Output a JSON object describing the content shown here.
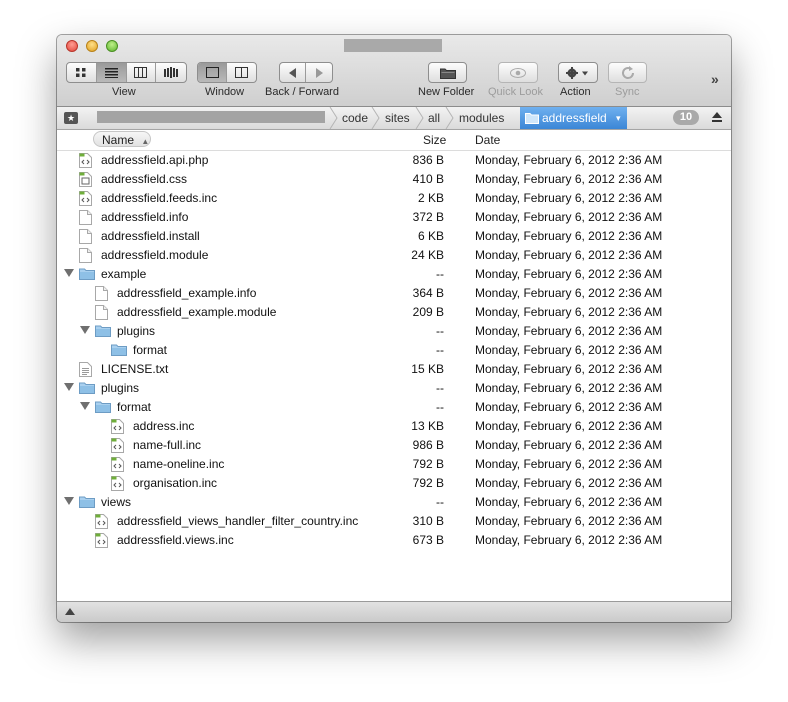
{
  "toolbar": {
    "view_label": "View",
    "window_label": "Window",
    "back_forward_label": "Back / Forward",
    "new_folder_label": "New Folder",
    "quick_look_label": "Quick Look",
    "action_label": "Action",
    "sync_label": "Sync",
    "overflow": "»"
  },
  "pathbar": {
    "crumbs": [
      "code",
      "sites",
      "all",
      "modules"
    ],
    "current": "addressfield",
    "item_count": "10"
  },
  "columns": {
    "name": "Name",
    "size": "Size",
    "date": "Date"
  },
  "rows": [
    {
      "name": "addressfield.api.php",
      "size": "836 B",
      "date": "Monday, February 6, 2012 2:36 AM",
      "icon": "code-file-icon",
      "indent": 0,
      "disclosure": "none"
    },
    {
      "name": "addressfield.css",
      "size": "410 B",
      "date": "Monday, February 6, 2012 2:36 AM",
      "icon": "css-file-icon",
      "indent": 0,
      "disclosure": "none"
    },
    {
      "name": "addressfield.feeds.inc",
      "size": "2 KB",
      "date": "Monday, February 6, 2012 2:36 AM",
      "icon": "code-file-icon",
      "indent": 0,
      "disclosure": "none"
    },
    {
      "name": "addressfield.info",
      "size": "372 B",
      "date": "Monday, February 6, 2012 2:36 AM",
      "icon": "blank-file-icon",
      "indent": 0,
      "disclosure": "none"
    },
    {
      "name": "addressfield.install",
      "size": "6 KB",
      "date": "Monday, February 6, 2012 2:36 AM",
      "icon": "blank-file-icon",
      "indent": 0,
      "disclosure": "none"
    },
    {
      "name": "addressfield.module",
      "size": "24 KB",
      "date": "Monday, February 6, 2012 2:36 AM",
      "icon": "blank-file-icon",
      "indent": 0,
      "disclosure": "none"
    },
    {
      "name": "example",
      "size": "--",
      "date": "Monday, February 6, 2012 2:36 AM",
      "icon": "folder-icon",
      "indent": 0,
      "disclosure": "open"
    },
    {
      "name": "addressfield_example.info",
      "size": "364 B",
      "date": "Monday, February 6, 2012 2:36 AM",
      "icon": "blank-file-icon",
      "indent": 1,
      "disclosure": "none"
    },
    {
      "name": "addressfield_example.module",
      "size": "209 B",
      "date": "Monday, February 6, 2012 2:36 AM",
      "icon": "blank-file-icon",
      "indent": 1,
      "disclosure": "none"
    },
    {
      "name": "plugins",
      "size": "--",
      "date": "Monday, February 6, 2012 2:36 AM",
      "icon": "folder-icon",
      "indent": 1,
      "disclosure": "open"
    },
    {
      "name": "format",
      "size": "--",
      "date": "Monday, February 6, 2012 2:36 AM",
      "icon": "folder-icon",
      "indent": 2,
      "disclosure": "closed"
    },
    {
      "name": "LICENSE.txt",
      "size": "15 KB",
      "date": "Monday, February 6, 2012 2:36 AM",
      "icon": "text-file-icon",
      "indent": 0,
      "disclosure": "none"
    },
    {
      "name": "plugins",
      "size": "--",
      "date": "Monday, February 6, 2012 2:36 AM",
      "icon": "folder-icon",
      "indent": 0,
      "disclosure": "open"
    },
    {
      "name": "format",
      "size": "--",
      "date": "Monday, February 6, 2012 2:36 AM",
      "icon": "folder-icon",
      "indent": 1,
      "disclosure": "open"
    },
    {
      "name": "address.inc",
      "size": "13 KB",
      "date": "Monday, February 6, 2012 2:36 AM",
      "icon": "code-file-icon",
      "indent": 2,
      "disclosure": "none"
    },
    {
      "name": "name-full.inc",
      "size": "986 B",
      "date": "Monday, February 6, 2012 2:36 AM",
      "icon": "code-file-icon",
      "indent": 2,
      "disclosure": "none"
    },
    {
      "name": "name-oneline.inc",
      "size": "792 B",
      "date": "Monday, February 6, 2012 2:36 AM",
      "icon": "code-file-icon",
      "indent": 2,
      "disclosure": "none"
    },
    {
      "name": "organisation.inc",
      "size": "792 B",
      "date": "Monday, February 6, 2012 2:36 AM",
      "icon": "code-file-icon",
      "indent": 2,
      "disclosure": "none"
    },
    {
      "name": "views",
      "size": "--",
      "date": "Monday, February 6, 2012 2:36 AM",
      "icon": "folder-icon",
      "indent": 0,
      "disclosure": "open"
    },
    {
      "name": "addressfield_views_handler_filter_country.inc",
      "size": "310 B",
      "date": "Monday, February 6, 2012 2:36 AM",
      "icon": "code-file-icon",
      "indent": 1,
      "disclosure": "none"
    },
    {
      "name": "addressfield.views.inc",
      "size": "673 B",
      "date": "Monday, February 6, 2012 2:36 AM",
      "icon": "code-file-icon",
      "indent": 1,
      "disclosure": "none"
    }
  ],
  "colors": {
    "accent": "#3b86d6",
    "folder": "#8ec0e6"
  }
}
